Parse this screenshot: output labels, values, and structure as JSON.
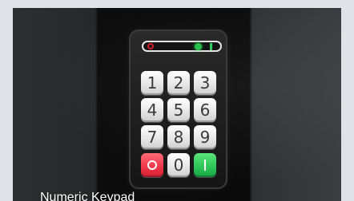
{
  "caption": "Numeric Keypad",
  "keypad": {
    "rows": [
      [
        "1",
        "2",
        "3"
      ],
      [
        "4",
        "5",
        "6"
      ],
      [
        "7",
        "8",
        "9"
      ]
    ],
    "zero_label": "0",
    "cancel_key": "red-circle-icon",
    "enter_key": "green-bar-icon"
  },
  "colors": {
    "cancel": "#f03a4b",
    "enter": "#2fc85a",
    "status_green": "#26c04a",
    "status_red": "#d61f2d"
  }
}
